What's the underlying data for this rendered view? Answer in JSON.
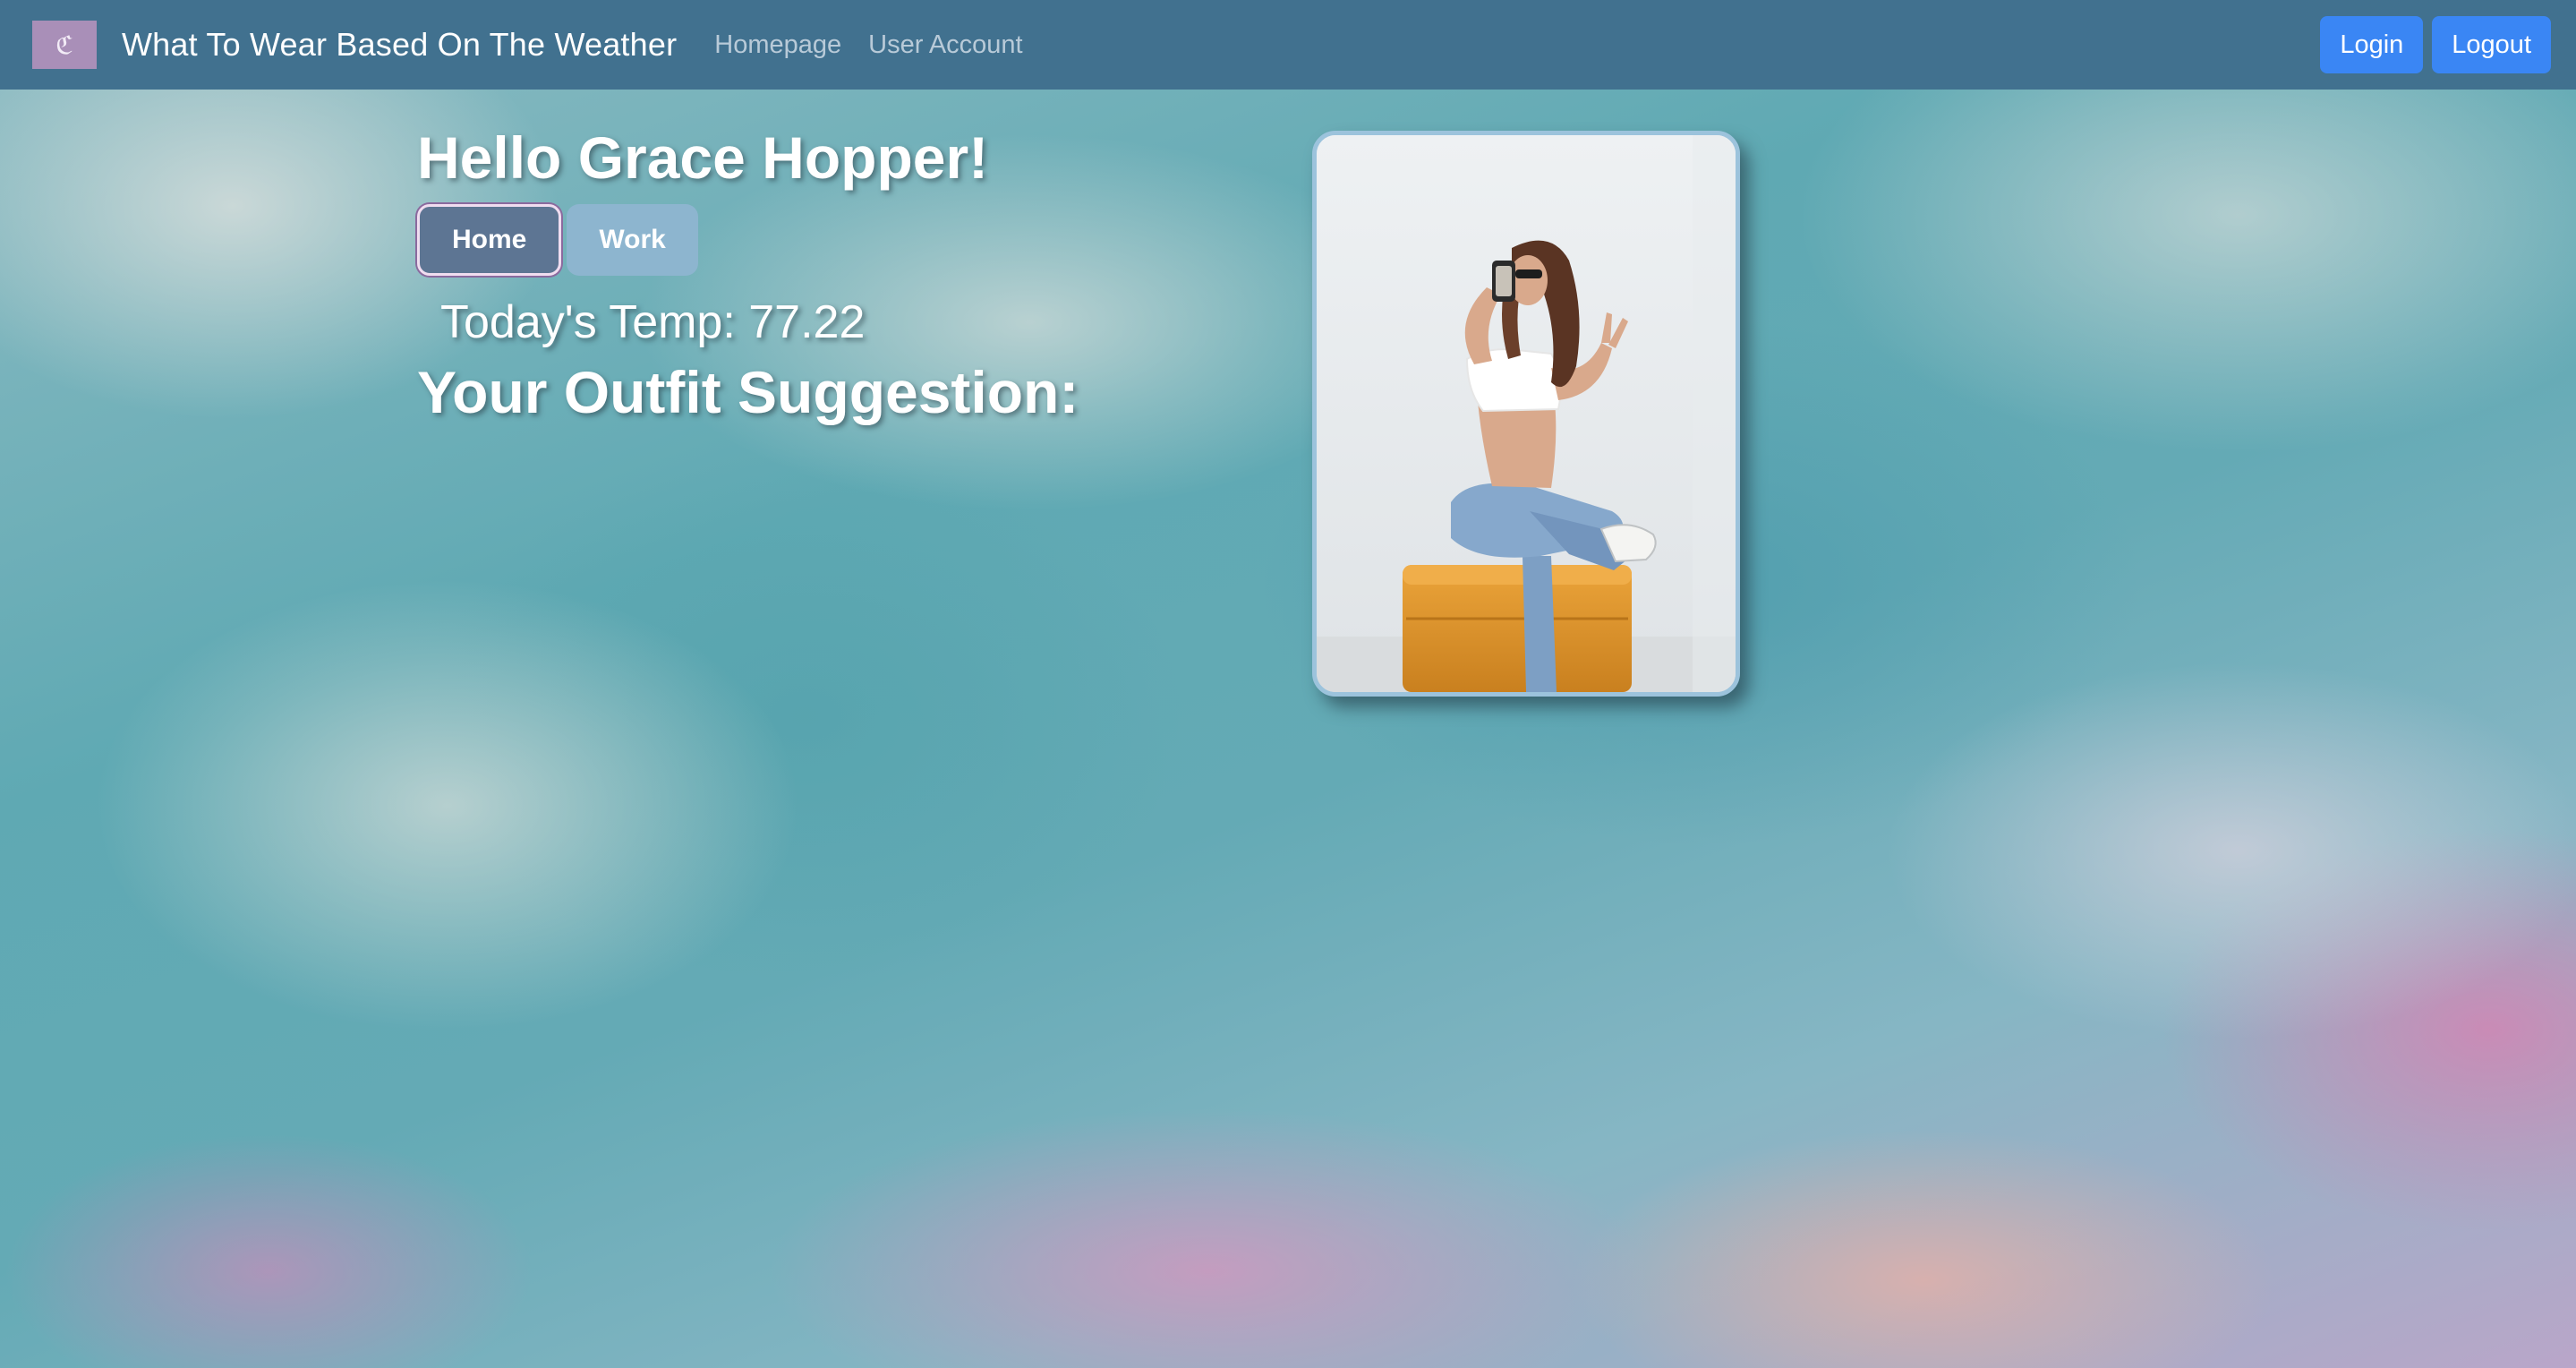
{
  "navbar": {
    "logo_icon": "hanger-logo-icon",
    "logo_glyph": "ℭ",
    "title": "What To Wear Based On The Weather",
    "links": [
      {
        "label": "Homepage"
      },
      {
        "label": "User Account"
      }
    ],
    "login_label": "Login",
    "logout_label": "Logout"
  },
  "main": {
    "greeting": "Hello Grace Hopper!",
    "toggle": {
      "home_label": "Home",
      "work_label": "Work",
      "selected": "Home"
    },
    "temperature_text": "Today's Temp: 77.22",
    "suggestion_title": "Your Outfit Suggestion:"
  },
  "photo": {
    "subject": "outfit-photo",
    "colors": {
      "top": "#ffffff",
      "jeans": "#7d9fc4",
      "stool": "#e29a2d",
      "hair": "#5a3423"
    }
  },
  "colors": {
    "navbar_bg": "#41718f",
    "button_blue": "#3a86f4",
    "toggle_active": "#5d7593",
    "toggle_inactive": "#8db5cf"
  }
}
